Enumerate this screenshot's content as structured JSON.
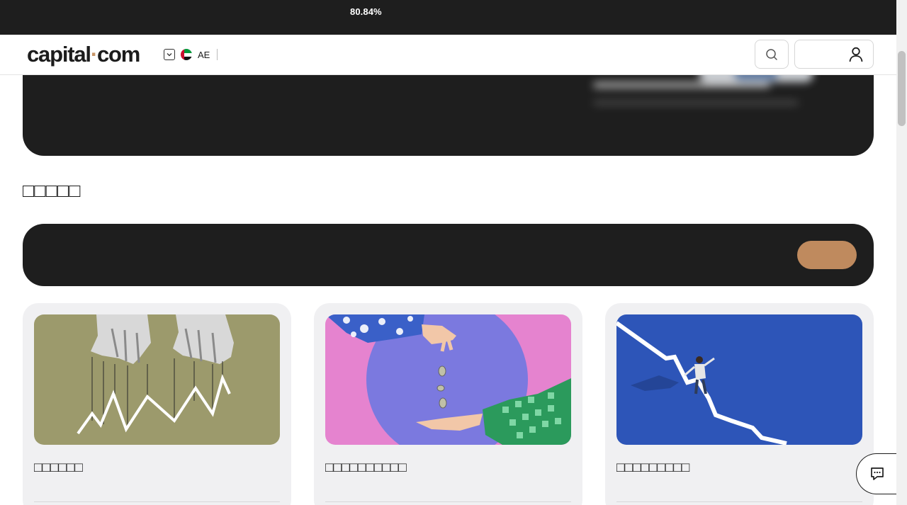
{
  "risk_banner": {
    "percentage": "80.84%"
  },
  "header": {
    "logo_part1": "capital",
    "logo_dot": "·",
    "logo_part2": "com",
    "region_code": "AE"
  },
  "section": {
    "title": "□□□□□"
  },
  "cards": [
    {
      "title": "□□□□□□"
    },
    {
      "title": "□□□□□□□□□□"
    },
    {
      "title": "□□□□□□□□□"
    }
  ],
  "colors": {
    "dark": "#1e1e1e",
    "accent": "#bf8a5e",
    "card_bg": "#f0f0f2",
    "card1_image": "#9c9a6c",
    "card3_image": "#2d55b8"
  },
  "icons": {
    "region_dropdown": "chevron-down-icon",
    "search": "search-icon",
    "account": "user-icon",
    "chat": "chat-icon"
  }
}
